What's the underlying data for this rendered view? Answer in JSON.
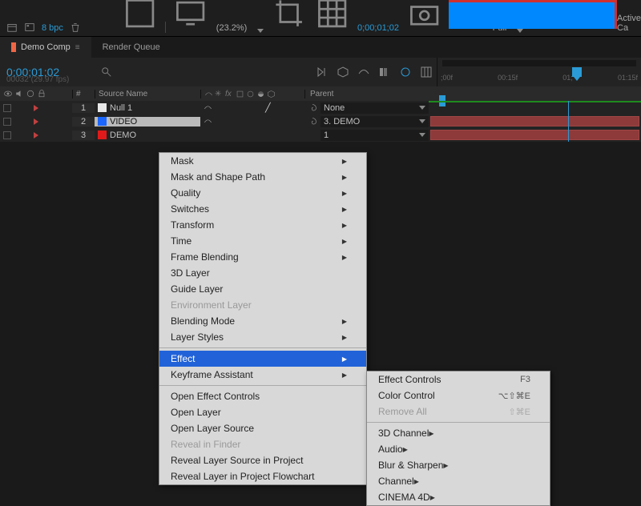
{
  "project_footer": {
    "bpc": "8 bpc",
    "zoom": "(23.2%)",
    "timecode": "0;00;01;02",
    "resolution": "Full",
    "camera": "Active Ca"
  },
  "tabs": [
    {
      "label": "Demo Comp",
      "active": true,
      "close": "≡"
    },
    {
      "label": "Render Queue",
      "active": false
    }
  ],
  "timeline_header": {
    "timecode": "0;00;01;02",
    "subtext": "00032 (29.97 fps)",
    "ruler_ticks": [
      ";00f",
      "00:15f",
      "01;",
      "01:15f"
    ]
  },
  "columns": {
    "num": "#",
    "source_name": "Source Name",
    "parent": "Parent"
  },
  "layers": [
    {
      "num": "1",
      "name": "Null 1",
      "color": "#e8e8e8",
      "parent": "None",
      "selected": false
    },
    {
      "num": "2",
      "name": "VIDEO",
      "color": "#1a66ff",
      "parent": "3. DEMO",
      "selected": true
    },
    {
      "num": "3",
      "name": "DEMO",
      "color": "#e01a1a",
      "parent": "1",
      "selected": false
    }
  ],
  "context_menu": {
    "items": [
      {
        "label": "Mask",
        "sub": true
      },
      {
        "label": "Mask and Shape Path",
        "sub": true
      },
      {
        "label": "Quality",
        "sub": true
      },
      {
        "label": "Switches",
        "sub": true
      },
      {
        "label": "Transform",
        "sub": true
      },
      {
        "label": "Time",
        "sub": true
      },
      {
        "label": "Frame Blending",
        "sub": true
      },
      {
        "label": "3D Layer"
      },
      {
        "label": "Guide Layer"
      },
      {
        "label": "Environment Layer",
        "disabled": true
      },
      {
        "label": "Blending Mode",
        "sub": true
      },
      {
        "label": "Layer Styles",
        "sub": true
      },
      {
        "sep": true
      },
      {
        "label": "Effect",
        "sub": true,
        "highlighted": true
      },
      {
        "label": "Keyframe Assistant",
        "sub": true
      },
      {
        "sep": true
      },
      {
        "label": "Open Effect Controls"
      },
      {
        "label": "Open Layer"
      },
      {
        "label": "Open Layer Source"
      },
      {
        "label": "Reveal in Finder",
        "disabled": true
      },
      {
        "label": "Reveal Layer Source in Project"
      },
      {
        "label": "Reveal Layer in Project Flowchart"
      }
    ],
    "submenu": [
      {
        "label": "Effect Controls",
        "shortcut": "F3"
      },
      {
        "label": "Color Control",
        "shortcut": "⌥⇧⌘E"
      },
      {
        "label": "Remove All",
        "shortcut": "⇧⌘E",
        "disabled": true
      },
      {
        "sep": true
      },
      {
        "label": "3D Channel",
        "sub": true
      },
      {
        "label": "Audio",
        "sub": true
      },
      {
        "label": "Blur & Sharpen",
        "sub": true
      },
      {
        "label": "Channel",
        "sub": true
      },
      {
        "label": "CINEMA 4D",
        "sub": true
      }
    ]
  }
}
